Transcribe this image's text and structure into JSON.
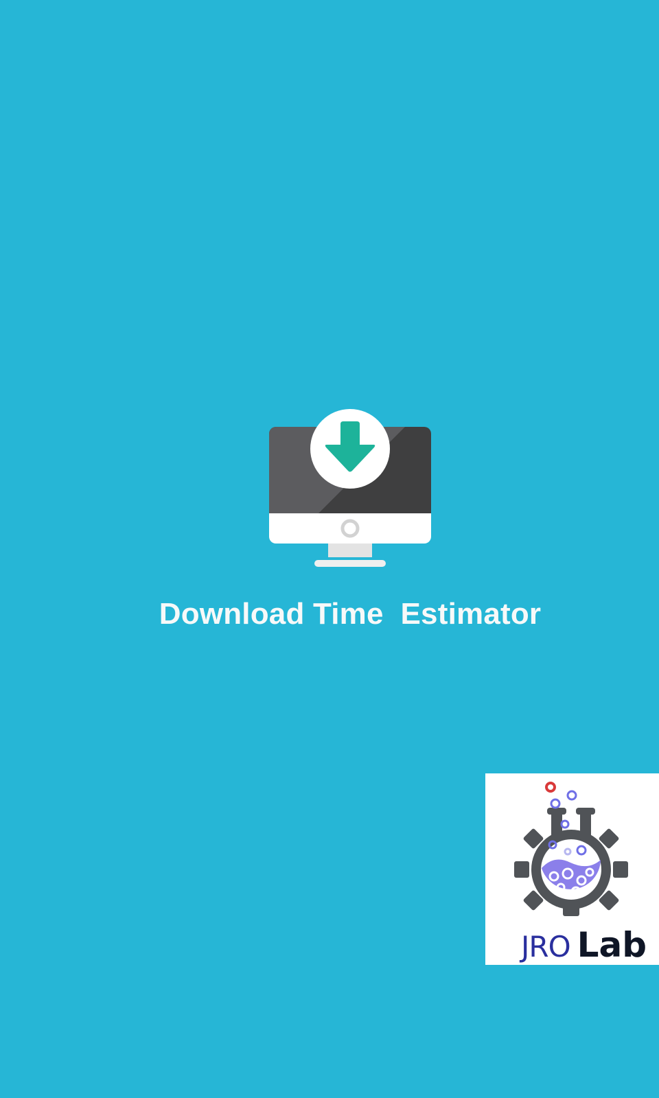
{
  "splash": {
    "app_title": "Download Time  Estimator",
    "app_icon": "monitor-download-icon",
    "background_color": "#26B6D6"
  },
  "logo": {
    "brand_primary": "JRO",
    "brand_secondary": "Lab",
    "icon": "gear-flask-icon"
  },
  "colors": {
    "arrow": "#1DB39A",
    "monitor_screen_dark": "#3F3F40",
    "monitor_screen_light": "#5C5C5F",
    "gear": "#505357",
    "liquid": "#8B7FEA",
    "small_gears": "#6F6FE6",
    "red_gear": "#D93A3A"
  }
}
